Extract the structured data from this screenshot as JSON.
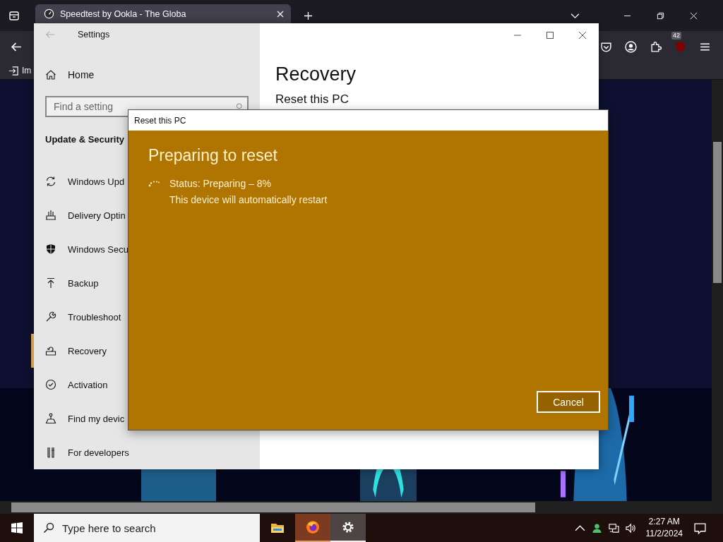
{
  "browser": {
    "tabs": [
      {
        "title": "Speedtest by Ookla - The Globa",
        "selected": true
      }
    ],
    "badge": "42",
    "bookmark": "Im"
  },
  "settings": {
    "title": "Settings",
    "home": "Home",
    "search": {
      "placeholder": "Find a setting"
    },
    "section": "Update & Security",
    "nav": [
      {
        "label": "Windows Upd",
        "selected": false
      },
      {
        "label": "Delivery Optin",
        "selected": false
      },
      {
        "label": "Windows Secu",
        "selected": false
      },
      {
        "label": "Backup",
        "selected": false
      },
      {
        "label": "Troubleshoot",
        "selected": false
      },
      {
        "label": "Recovery",
        "selected": true
      },
      {
        "label": "Activation",
        "selected": false
      },
      {
        "label": "Find my devic",
        "selected": false
      },
      {
        "label": "For developers",
        "selected": false
      }
    ],
    "page_title": "Recovery",
    "subheading": "Reset this PC"
  },
  "dialog": {
    "title": "Reset this PC",
    "heading": "Preparing to reset",
    "status": "Status: Preparing – 8%",
    "note": "This device will automatically restart",
    "button": "Cancel"
  },
  "taskbar": {
    "search": {
      "placeholder": "Type here to search"
    },
    "apps": [
      {
        "kind": "folder",
        "open": false,
        "selected": false
      },
      {
        "kind": "firefox",
        "open": true,
        "selected": false
      },
      {
        "kind": "settings",
        "open": true,
        "selected": true
      }
    ],
    "time": "2:27 AM",
    "date": "11/2/2024"
  }
}
